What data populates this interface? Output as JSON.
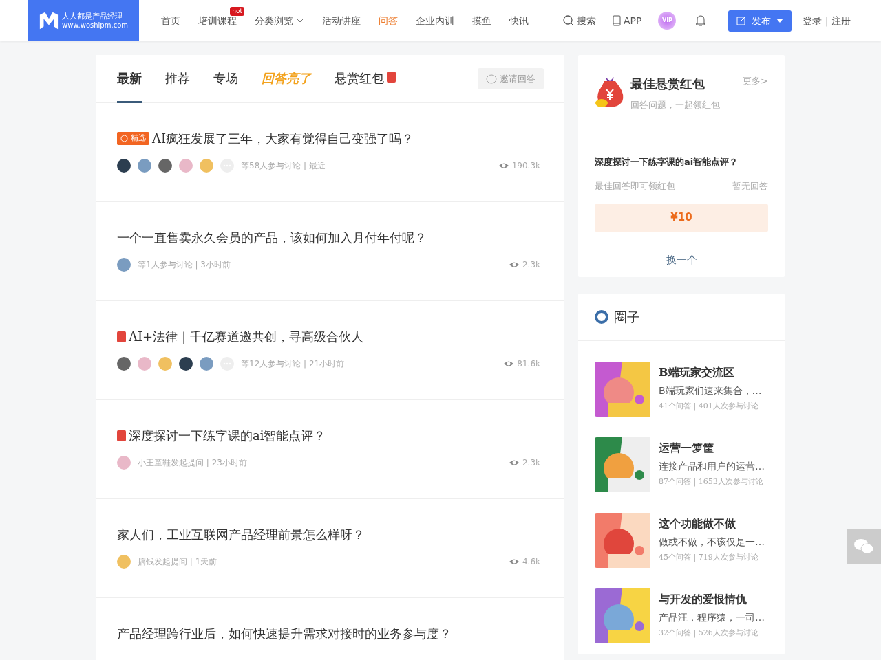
{
  "header": {
    "logo": {
      "name": "人人都是产品经理",
      "url": "www.woshipm.com"
    },
    "nav": [
      {
        "label": "首页",
        "selected": false
      },
      {
        "label": "培训课程",
        "selected": false,
        "badge": "hot"
      },
      {
        "label": "分类浏览",
        "selected": false,
        "dropdown": true
      },
      {
        "label": "活动讲座",
        "selected": false
      },
      {
        "label": "问答",
        "selected": true
      },
      {
        "label": "企业内训",
        "selected": false
      },
      {
        "label": "摸鱼",
        "selected": false
      },
      {
        "label": "快讯",
        "selected": false
      }
    ],
    "search": "搜索",
    "app": "APP",
    "vip": "VIP",
    "publish": "发布",
    "login": "登录 | 注册"
  },
  "tabs": [
    {
      "label": "最新",
      "selected": true,
      "kind": "text"
    },
    {
      "label": "推荐",
      "selected": false,
      "kind": "text"
    },
    {
      "label": "专场",
      "selected": false,
      "kind": "text"
    },
    {
      "label": "回答亮了",
      "selected": false,
      "kind": "highlight"
    },
    {
      "label": "悬赏红包",
      "selected": false,
      "kind": "reward"
    }
  ],
  "invite_button": "邀请回答",
  "questions": [
    {
      "title": "AI疯狂发展了三年，大家有觉得自己变强了吗？",
      "tag": {
        "kind": "featured",
        "label": "精选"
      },
      "avatars": [
        {
          "kind": "picture"
        },
        {
          "kind": "picture"
        },
        {
          "kind": "picture"
        },
        {
          "kind": "picture"
        },
        {
          "kind": "picture"
        },
        {
          "kind": "more"
        }
      ],
      "meta": "等58人参与讨论 | 最近",
      "views": "190.3k"
    },
    {
      "title": "一个一直售卖永久会员的产品，该如何加入月付年付呢？",
      "avatars": [
        {
          "kind": "picture"
        }
      ],
      "meta": "等1人参与讨论 | 3小时前",
      "views": "2.3k"
    },
    {
      "title": "AI+法律｜千亿赛道邀共创，寻高级合伙人",
      "tag": {
        "kind": "reward"
      },
      "avatars": [
        {
          "kind": "picture"
        },
        {
          "kind": "picture"
        },
        {
          "kind": "picture"
        },
        {
          "kind": "picture"
        },
        {
          "kind": "picture"
        },
        {
          "kind": "more"
        }
      ],
      "meta": "等12人参与讨论 | 21小时前",
      "views": "81.6k"
    },
    {
      "title": "深度探讨一下练字课的ai智能点评？",
      "tag": {
        "kind": "reward"
      },
      "avatars": [
        {
          "kind": "picture"
        }
      ],
      "meta": "小王童鞋发起提问 | 23小时前",
      "views": "2.3k"
    },
    {
      "title": "家人们，工业互联网产品经理前景怎么样呀？",
      "avatars": [
        {
          "kind": "picture"
        }
      ],
      "meta": "搞钱发起提问 | 1天前",
      "views": "4.6k"
    },
    {
      "title": "产品经理跨行业后，如何快速提升需求对接时的业务参与度？"
    }
  ],
  "reward_card": {
    "title": "最佳悬赏红包",
    "more": "更多>",
    "subtitle": "回答问题，一起领红包",
    "question": "深度探讨一下练字课的ai智能点评？",
    "hint": "最佳回答即可领红包",
    "status": "暂无回答",
    "amount": "¥10",
    "switch": "换一个"
  },
  "circles": {
    "title": "圈子",
    "items": [
      {
        "name": "B端玩家交流区",
        "desc": "B端玩家们速来集合，…",
        "stats": "41个问答 | 401人次参与讨论",
        "kind": "picture"
      },
      {
        "name": "运营一箩筐",
        "desc": "连接产品和用户的运营…",
        "stats": "87个问答 | 1653人次参与讨论",
        "kind": "picture"
      },
      {
        "name": "这个功能做不做",
        "desc": "做或不做，不该仅是一…",
        "stats": "45个问答 | 719人次参与讨论",
        "kind": "picture"
      },
      {
        "name": "与开发的爱恨情仇",
        "desc": "产品汪，程序猿，一司…",
        "stats": "32个问答 | 526人次参与讨论",
        "kind": "picture"
      }
    ]
  }
}
